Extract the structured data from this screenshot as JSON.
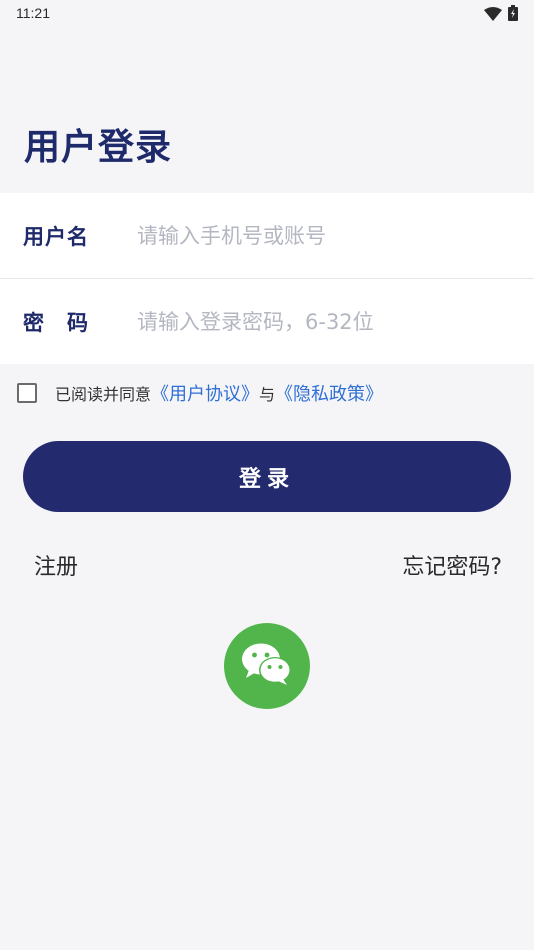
{
  "status_bar": {
    "time": "11:21",
    "icons": [
      "wifi-icon",
      "battery-icon"
    ]
  },
  "page_title": "用户登录",
  "form": {
    "username": {
      "label": "用户名",
      "placeholder": "请输入手机号或账号",
      "value": ""
    },
    "password": {
      "label": "密　码",
      "placeholder": "请输入登录密码，6-32位",
      "value": ""
    }
  },
  "agreement": {
    "checked": false,
    "prefix": "已阅读并同意",
    "user_agreement": "《用户协议》",
    "conjunction": "与",
    "privacy_policy": "《隐私政策》"
  },
  "login_button_label": "登录",
  "register_label": "注册",
  "forgot_password_label": "忘记密码?",
  "wechat_login": {
    "icon": "wechat-icon"
  },
  "colors": {
    "primary": "#232a6d",
    "link": "#2f6fd6",
    "wechat": "#52b54b",
    "background": "#f5f5f8"
  }
}
